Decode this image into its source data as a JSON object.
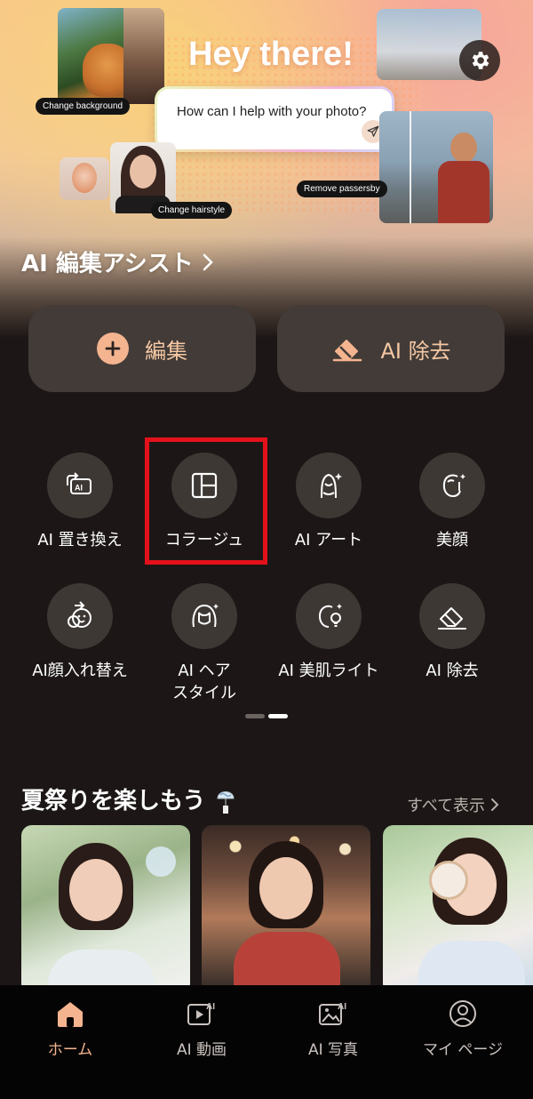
{
  "hero": {
    "title": "Hey there!",
    "prompt_placeholder": "How can I help with your photo?",
    "tags": {
      "change_background": "Change background",
      "change_hairstyle": "Change hairstyle",
      "remove_passersby": "Remove passersby"
    }
  },
  "assist": {
    "title": "AI 編集アシスト",
    "chevron": "chevron-right-icon"
  },
  "primary_actions": {
    "edit_label": "編集",
    "remove_label": "AI 除去"
  },
  "tools": {
    "row1": [
      {
        "label": "AI 置き換え",
        "icon": "ai-replace-icon"
      },
      {
        "label": "コラージュ",
        "icon": "collage-icon"
      },
      {
        "label": "AI アート",
        "icon": "ai-art-icon"
      },
      {
        "label": "美顔",
        "icon": "face-beauty-icon"
      }
    ],
    "row2": [
      {
        "label": "AI顔入れ替え",
        "icon": "face-swap-icon"
      },
      {
        "label": "AI ヘア",
        "label2": "スタイル",
        "icon": "hairstyle-icon"
      },
      {
        "label": "AI 美肌ライト",
        "icon": "skin-light-icon"
      },
      {
        "label": "AI 除去",
        "icon": "eraser-icon"
      }
    ]
  },
  "section": {
    "title": "夏祭りを楽しもう",
    "see_all": "すべて表示"
  },
  "nav": {
    "items": [
      {
        "label": "ホーム",
        "icon": "home-icon",
        "active": true
      },
      {
        "label": "AI 動画",
        "icon": "ai-video-icon"
      },
      {
        "label": "AI 写真",
        "icon": "ai-photo-icon"
      },
      {
        "label": "マイ ページ",
        "icon": "profile-icon"
      }
    ]
  },
  "colors": {
    "accent": "#f4b48f",
    "background": "#1c1716",
    "card": "#423b38",
    "highlight": "#e4111b"
  }
}
